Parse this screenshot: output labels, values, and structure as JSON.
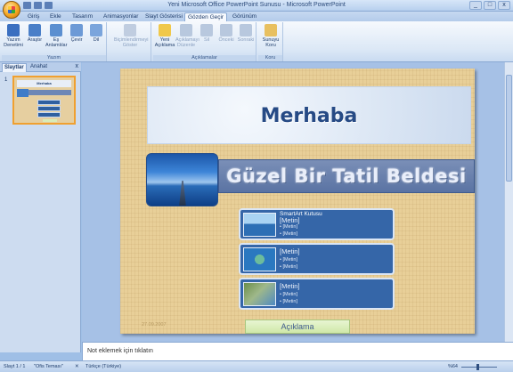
{
  "window": {
    "title": "Yeni Microsoft Office PowerPoint Sunusu - Microsoft PowerPoint",
    "controls": [
      "_",
      "□",
      "x"
    ]
  },
  "ribbon_tabs": [
    {
      "label": "Giriş"
    },
    {
      "label": "Ekle"
    },
    {
      "label": "Tasarım"
    },
    {
      "label": "Animasyonlar"
    },
    {
      "label": "Slayt Gösterisi"
    },
    {
      "label": "Gözden Geçir"
    },
    {
      "label": "Görünüm"
    }
  ],
  "active_tab": "Gözden Geçir",
  "ribbon": {
    "groups": [
      {
        "label": "Yazım",
        "buttons": [
          {
            "label": "Yazım Denetimi",
            "icon": "spelling-icon",
            "color": "#3a6fc0"
          },
          {
            "label": "Araştır",
            "icon": "research-icon",
            "color": "#4a7fc8"
          },
          {
            "label": "Eş Anlamlılar",
            "icon": "thesaurus-icon",
            "color": "#5b8fd0"
          },
          {
            "label": "Çevir",
            "icon": "translate-icon",
            "color": "#6d9ad6"
          },
          {
            "label": "Dil",
            "icon": "language-icon",
            "color": "#7ba5dc"
          }
        ]
      },
      {
        "label": "",
        "buttons": [
          {
            "label": "Biçimlendirmeyi Göster",
            "icon": "show-markup-icon",
            "color": "#c0cde0"
          }
        ]
      },
      {
        "label": "Açıklamalar",
        "buttons": [
          {
            "label": "Yeni Açıklama",
            "icon": "new-comment-icon",
            "color": "#f0c84a"
          },
          {
            "label": "Açıklamayı Düzenle",
            "icon": "edit-comment-icon",
            "color": "#b8c8de"
          },
          {
            "label": "Sil",
            "icon": "delete-comment-icon",
            "color": "#b8c8de"
          },
          {
            "label": "Önceki",
            "icon": "previous-comment-icon",
            "color": "#b8c8de"
          },
          {
            "label": "Sonraki",
            "icon": "next-comment-icon",
            "color": "#b8c8de"
          }
        ]
      },
      {
        "label": "Koru",
        "buttons": [
          {
            "label": "Sunuyu Koru",
            "icon": "protect-icon",
            "color": "#e8c060"
          }
        ]
      }
    ]
  },
  "left_panel": {
    "tabs": [
      "Slaytlar",
      "Anahat"
    ],
    "close": "x",
    "slide_number": "1",
    "thumb_title": "Merhaba"
  },
  "slide": {
    "title": "Merhaba",
    "subtitle": "Güzel Bir Tatil Beldesi",
    "smartart": [
      {
        "heading": "[Metin]",
        "caption": "SmartArt Kutusu",
        "items": [
          "[Metin]",
          "[Metin]"
        ],
        "image": "whale-photo"
      },
      {
        "heading": "[Metin]",
        "caption": "",
        "items": [
          "[Metin]",
          "[Metin]"
        ],
        "image": "turtle-photo"
      },
      {
        "heading": "[Metin]",
        "caption": "",
        "items": [
          "[Metin]",
          "[Metin]"
        ],
        "image": "rocks-photo"
      }
    ],
    "button_label": "Açıklama",
    "date": "27.09.2007"
  },
  "notes": {
    "placeholder": "Not eklemek için tıklatın"
  },
  "status": {
    "slide_info": "Slayt 1 / 1",
    "theme": "\"Ofis Teması\"",
    "language": "Türkçe (Türkiye)",
    "zoom": "%64"
  }
}
